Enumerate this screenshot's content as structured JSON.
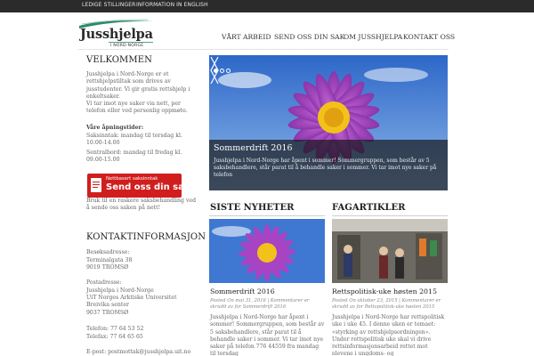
{
  "topbar": {
    "links": [
      "LEDIGE STILLINGER",
      "INFORMATION IN ENGLISH"
    ]
  },
  "logo": {
    "title": "Jusshjelpa",
    "subtitle": "I NORD-NORGE"
  },
  "nav": {
    "items": [
      "VÅRT ARBEID",
      "SEND OSS DIN SAK",
      "OM JUSSHJELPA",
      "KONTAKT OSS"
    ]
  },
  "welcome": {
    "heading": "VELKOMMEN",
    "p1": "Jusshjelpa i Nord-Norge er et rettshjelpstiltak som drives av jusstudenter. Vi gir gratis rettshjelp i enkeltsaker.",
    "p2": "Vi tar imot nye saker via nett, per telefon eller ved personlig oppmøte.",
    "hours_heading": "Våre åpningstider:",
    "hours_1": "Saksinntak: mandag til torsdag kl. 10.00-14.00",
    "hours_2": "Sentralbord: mandag til fredag kl. 09.00-15.00",
    "cta_small": "Nettbasert saksinntak",
    "cta_big": "Send oss din sak",
    "cta_note": "Bruk til en raskere saksbehandling ved å sende oss saken på nett!"
  },
  "contact": {
    "heading": "KONTAKTINFORMASJON",
    "visit_label": "Besøksadresse:",
    "visit_1": "Terminalgata 38",
    "visit_2": "9019 TROMSØ",
    "post_label": "Postadresse:",
    "post_1": "Jusshjelpa i Nord-Norge",
    "post_2": "UiT Norges Arktiske Universitet",
    "post_3": "Breivika senter",
    "post_4": "9037 TROMSØ",
    "phone": "Telefon: 77 64 53 52",
    "fax": "Telefax: 77 64 65 65",
    "email": "E-post: postmottak@jusshjelpa.uit.no"
  },
  "slider": {
    "title": "Sommerdrift 2016",
    "text": "Jusshjelpa i Nord-Norge har åpent i sommer! Sommergruppen, som består av 5 saksbehandlere, står parat til å behandle saker i sommer. Vi tar imot nye saker på telefon"
  },
  "news": {
    "heading": "SISTE NYHETER",
    "title": "Sommerdrift 2016",
    "meta": "Posted On mai 31, 2016 | Kommentarer er skrudd av for Sommerdrift 2016",
    "excerpt": "Jusshjelpa i Nord-Norge har åpent i sommer! Sommergruppen, som består av 5 saksbehandlere, står parat til å behandle saker i sommer. Vi tar imot nye saker på telefon 776 44559 fra mandag til torsdag"
  },
  "articles": {
    "heading": "FAGARTIKLER",
    "title": "Rettspolitisk-uke høsten 2015",
    "meta": "Posted On oktober 23, 2015 | Kommentarer er skrudd av for Rettspolitisk-uke høsten 2015",
    "excerpt": "Jusshjelpa i Nord-Norge har rettspolitisk uke i uke 45. I denne uken er temaet: «styrking av rettshjelpsordningen». Under rettspolitisk uke skal vi drive rettsinformasjonsarbeid rettet mot elevene i ungdoms- og"
  },
  "colors": {
    "topbar": "#2b2b2b",
    "cta": "#d01e1e",
    "logo_accent": "#2f8a6a"
  }
}
